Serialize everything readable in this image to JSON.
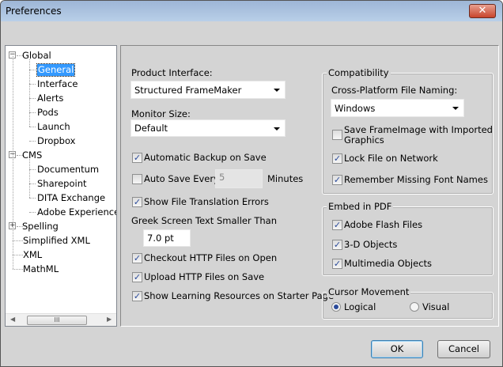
{
  "window": {
    "title": "Preferences",
    "close_icon": "close-icon"
  },
  "tree": {
    "items": [
      {
        "label": "Global",
        "level": 0,
        "expander": "-"
      },
      {
        "label": "General",
        "level": 1,
        "selected": true
      },
      {
        "label": "Interface",
        "level": 1
      },
      {
        "label": "Alerts",
        "level": 1
      },
      {
        "label": "Pods",
        "level": 1
      },
      {
        "label": "Launch",
        "level": 1
      },
      {
        "label": "Dropbox",
        "level": 1
      },
      {
        "label": "CMS",
        "level": 0,
        "expander": "-"
      },
      {
        "label": "Documentum",
        "level": 1
      },
      {
        "label": "Sharepoint",
        "level": 1
      },
      {
        "label": "DITA Exchange",
        "level": 1
      },
      {
        "label": "Adobe Experience M",
        "level": 1
      },
      {
        "label": "Spelling",
        "level": 0,
        "expander": "+"
      },
      {
        "label": "Simplified XML",
        "level": 0
      },
      {
        "label": "XML",
        "level": 0
      },
      {
        "label": "MathML",
        "level": 0
      }
    ],
    "scroll_thumb": "III"
  },
  "general": {
    "product_interface_label": "Product Interface:",
    "product_interface_value": "Structured FrameMaker",
    "monitor_size_label": "Monitor Size:",
    "monitor_size_value": "Default",
    "auto_backup": {
      "label": "Automatic Backup on Save",
      "checked": true
    },
    "auto_save": {
      "label": "Auto Save Every",
      "checked": false,
      "value": "5",
      "unit": "Minutes"
    },
    "show_errors": {
      "label": "Show File Translation Errors",
      "checked": true
    },
    "greek_label": "Greek Screen Text Smaller Than",
    "greek_value": "7.0 pt",
    "checkout_http": {
      "label": "Checkout HTTP Files on Open",
      "checked": true
    },
    "upload_http": {
      "label": "Upload HTTP Files on Save",
      "checked": true
    },
    "learning": {
      "label": "Show Learning Resources on Starter Page",
      "checked": true
    }
  },
  "compatibility": {
    "title": "Compatibility",
    "naming_label": "Cross-Platform File Naming:",
    "naming_value": "Windows",
    "save_frameimage": {
      "label1": "Save FrameImage with Imported",
      "label2": "Graphics",
      "checked": false
    },
    "lock_file": {
      "label": "Lock File on Network",
      "checked": true
    },
    "remember_fonts": {
      "label": "Remember Missing Font Names",
      "checked": true
    }
  },
  "embed_pdf": {
    "title": "Embed in PDF",
    "flash": {
      "label": "Adobe Flash Files",
      "checked": true
    },
    "objects3d": {
      "label": "3-D Objects",
      "checked": true
    },
    "multimedia": {
      "label": "Multimedia Objects",
      "checked": true
    }
  },
  "cursor": {
    "title": "Cursor Movement",
    "logical": "Logical",
    "visual": "Visual",
    "selected": "Logical"
  },
  "buttons": {
    "ok": "OK",
    "cancel": "Cancel"
  }
}
